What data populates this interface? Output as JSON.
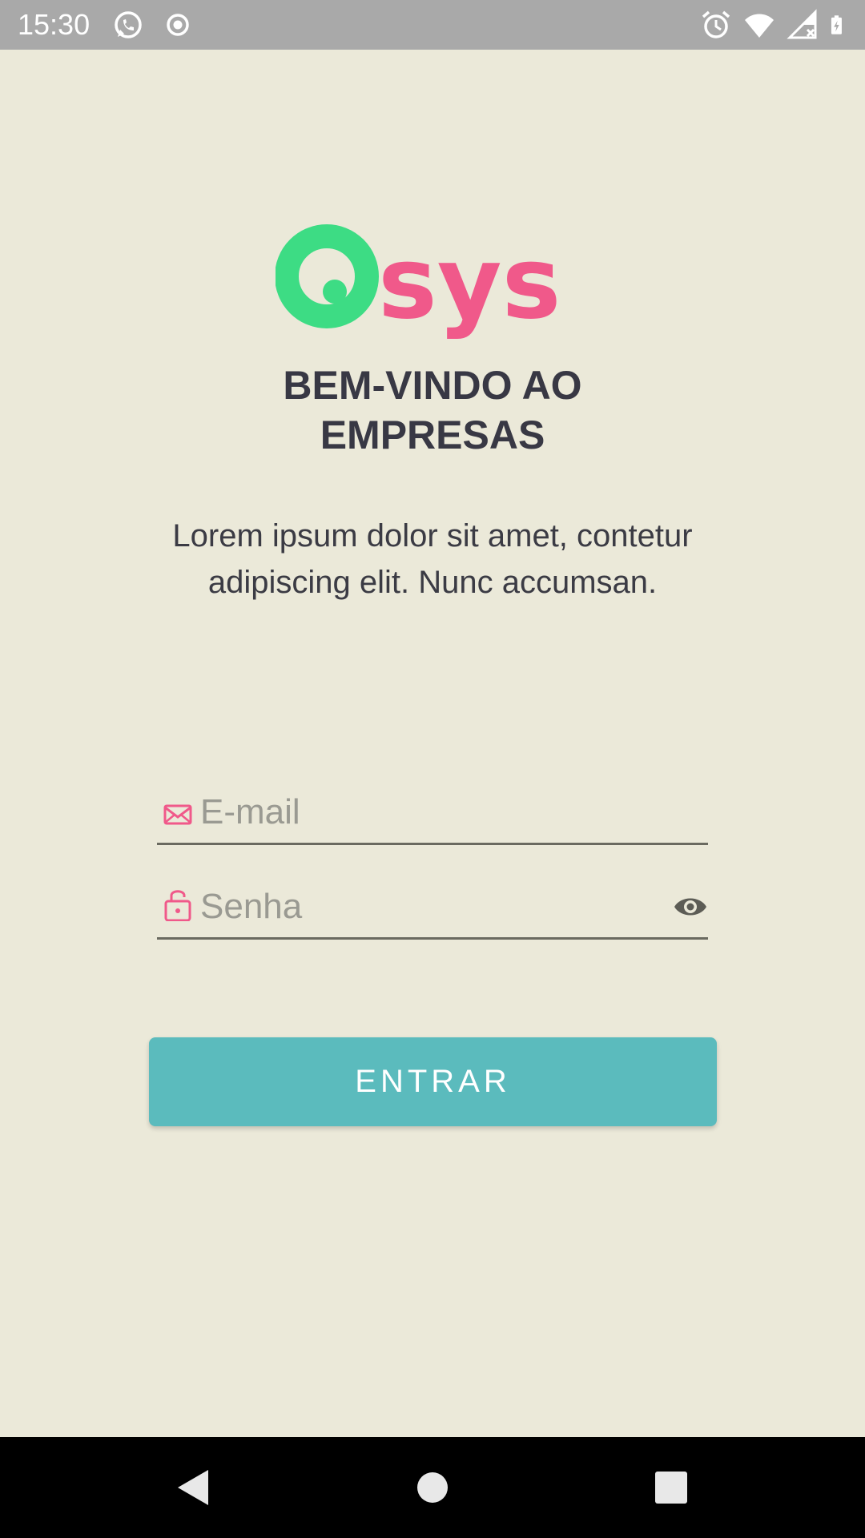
{
  "status_bar": {
    "time": "15:30",
    "left_icons": [
      "whatsapp-icon",
      "record-icon"
    ],
    "right_icons": [
      "alarm-icon",
      "wifi-icon",
      "signal-icon",
      "battery-charging-icon"
    ]
  },
  "logo": {
    "text": "Qsys",
    "colors": {
      "q": "#3ddc84",
      "sys": "#f0598a"
    }
  },
  "welcome": {
    "line1": "BEM-VINDO AO",
    "line2": "EMPRESAS"
  },
  "description": {
    "line1": "Lorem ipsum dolor sit amet, contetur",
    "line2": "adipiscing elit. Nunc accumsan."
  },
  "form": {
    "email": {
      "placeholder": "E-mail",
      "value": "",
      "icon": "mail-icon"
    },
    "password": {
      "placeholder": "Senha",
      "value": "",
      "icon": "lock-icon",
      "toggle_icon": "eye-icon"
    },
    "submit_label": "ENTRAR"
  },
  "nav_bar": {
    "buttons": [
      "back-icon",
      "home-icon",
      "recents-icon"
    ]
  },
  "colors": {
    "background": "#ebe9d9",
    "accent_pink": "#f0598a",
    "accent_green": "#3ddc84",
    "button": "#5bbbbd",
    "title_text": "#383844"
  }
}
